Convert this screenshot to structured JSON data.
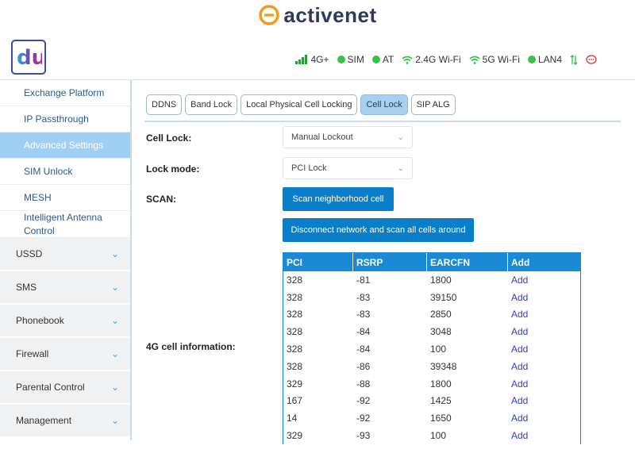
{
  "brand": {
    "name": "activenet"
  },
  "header": {
    "logo_text": "du",
    "status": [
      {
        "label": "4G+",
        "icon": "signal-bars-icon"
      },
      {
        "label": "SIM",
        "icon": "green-dot-icon"
      },
      {
        "label": "AT",
        "icon": "green-dot-icon"
      },
      {
        "label": "2.4G Wi-Fi",
        "icon": "wifi-icon"
      },
      {
        "label": "5G Wi-Fi",
        "icon": "wifi-icon"
      },
      {
        "label": "LAN4",
        "icon": "green-dot-icon"
      }
    ],
    "colors": {
      "green": "#36c24a",
      "red": "#e03030"
    }
  },
  "sidebar": {
    "sub_items": [
      {
        "label": "Exchange Platform"
      },
      {
        "label": "IP Passthrough"
      },
      {
        "label": "Advanced Settings",
        "active": true
      },
      {
        "label": "SIM Unlock"
      },
      {
        "label": "MESH"
      },
      {
        "label": "Intelligent Antenna Control"
      }
    ],
    "menu_items": [
      {
        "label": "USSD"
      },
      {
        "label": "SMS"
      },
      {
        "label": "Phonebook"
      },
      {
        "label": "Firewall"
      },
      {
        "label": "Parental Control"
      },
      {
        "label": "Management"
      }
    ]
  },
  "tabs": [
    {
      "label": "DDNS"
    },
    {
      "label": "Band Lock"
    },
    {
      "label": "Local Physical Cell Locking"
    },
    {
      "label": "Cell Lock",
      "active": true
    },
    {
      "label": "SIP ALG"
    }
  ],
  "form": {
    "cell_lock_label": "Cell Lock:",
    "cell_lock_value": "Manual Lockout",
    "lock_mode_label": "Lock mode:",
    "lock_mode_value": "PCI Lock",
    "scan_label": "SCAN:",
    "scan_button": "Scan neighborhood cell",
    "disconnect_button": "Disconnect network and scan all cells around",
    "cell_info_label": "4G cell information:"
  },
  "table": {
    "headers": [
      "PCI",
      "RSRP",
      "EARCFN",
      "Add"
    ],
    "rows": [
      [
        "328",
        "-81",
        "1800",
        "Add"
      ],
      [
        "328",
        "-83",
        "39150",
        "Add"
      ],
      [
        "328",
        "-83",
        "2850",
        "Add"
      ],
      [
        "328",
        "-84",
        "3048",
        "Add"
      ],
      [
        "328",
        "-84",
        "100",
        "Add"
      ],
      [
        "328",
        "-86",
        "39348",
        "Add"
      ],
      [
        "329",
        "-88",
        "1800",
        "Add"
      ],
      [
        "167",
        "-92",
        "1425",
        "Add"
      ],
      [
        "14",
        "-92",
        "1650",
        "Add"
      ],
      [
        "329",
        "-93",
        "100",
        "Add"
      ]
    ]
  }
}
